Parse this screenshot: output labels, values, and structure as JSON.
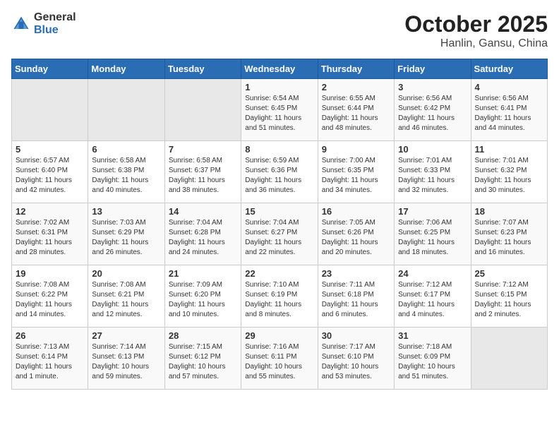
{
  "header": {
    "logo_general": "General",
    "logo_blue": "Blue",
    "title": "October 2025",
    "subtitle": "Hanlin, Gansu, China"
  },
  "weekdays": [
    "Sunday",
    "Monday",
    "Tuesday",
    "Wednesday",
    "Thursday",
    "Friday",
    "Saturday"
  ],
  "weeks": [
    [
      {
        "day": "",
        "info": ""
      },
      {
        "day": "",
        "info": ""
      },
      {
        "day": "",
        "info": ""
      },
      {
        "day": "1",
        "info": "Sunrise: 6:54 AM\nSunset: 6:45 PM\nDaylight: 11 hours\nand 51 minutes."
      },
      {
        "day": "2",
        "info": "Sunrise: 6:55 AM\nSunset: 6:44 PM\nDaylight: 11 hours\nand 48 minutes."
      },
      {
        "day": "3",
        "info": "Sunrise: 6:56 AM\nSunset: 6:42 PM\nDaylight: 11 hours\nand 46 minutes."
      },
      {
        "day": "4",
        "info": "Sunrise: 6:56 AM\nSunset: 6:41 PM\nDaylight: 11 hours\nand 44 minutes."
      }
    ],
    [
      {
        "day": "5",
        "info": "Sunrise: 6:57 AM\nSunset: 6:40 PM\nDaylight: 11 hours\nand 42 minutes."
      },
      {
        "day": "6",
        "info": "Sunrise: 6:58 AM\nSunset: 6:38 PM\nDaylight: 11 hours\nand 40 minutes."
      },
      {
        "day": "7",
        "info": "Sunrise: 6:58 AM\nSunset: 6:37 PM\nDaylight: 11 hours\nand 38 minutes."
      },
      {
        "day": "8",
        "info": "Sunrise: 6:59 AM\nSunset: 6:36 PM\nDaylight: 11 hours\nand 36 minutes."
      },
      {
        "day": "9",
        "info": "Sunrise: 7:00 AM\nSunset: 6:35 PM\nDaylight: 11 hours\nand 34 minutes."
      },
      {
        "day": "10",
        "info": "Sunrise: 7:01 AM\nSunset: 6:33 PM\nDaylight: 11 hours\nand 32 minutes."
      },
      {
        "day": "11",
        "info": "Sunrise: 7:01 AM\nSunset: 6:32 PM\nDaylight: 11 hours\nand 30 minutes."
      }
    ],
    [
      {
        "day": "12",
        "info": "Sunrise: 7:02 AM\nSunset: 6:31 PM\nDaylight: 11 hours\nand 28 minutes."
      },
      {
        "day": "13",
        "info": "Sunrise: 7:03 AM\nSunset: 6:29 PM\nDaylight: 11 hours\nand 26 minutes."
      },
      {
        "day": "14",
        "info": "Sunrise: 7:04 AM\nSunset: 6:28 PM\nDaylight: 11 hours\nand 24 minutes."
      },
      {
        "day": "15",
        "info": "Sunrise: 7:04 AM\nSunset: 6:27 PM\nDaylight: 11 hours\nand 22 minutes."
      },
      {
        "day": "16",
        "info": "Sunrise: 7:05 AM\nSunset: 6:26 PM\nDaylight: 11 hours\nand 20 minutes."
      },
      {
        "day": "17",
        "info": "Sunrise: 7:06 AM\nSunset: 6:25 PM\nDaylight: 11 hours\nand 18 minutes."
      },
      {
        "day": "18",
        "info": "Sunrise: 7:07 AM\nSunset: 6:23 PM\nDaylight: 11 hours\nand 16 minutes."
      }
    ],
    [
      {
        "day": "19",
        "info": "Sunrise: 7:08 AM\nSunset: 6:22 PM\nDaylight: 11 hours\nand 14 minutes."
      },
      {
        "day": "20",
        "info": "Sunrise: 7:08 AM\nSunset: 6:21 PM\nDaylight: 11 hours\nand 12 minutes."
      },
      {
        "day": "21",
        "info": "Sunrise: 7:09 AM\nSunset: 6:20 PM\nDaylight: 11 hours\nand 10 minutes."
      },
      {
        "day": "22",
        "info": "Sunrise: 7:10 AM\nSunset: 6:19 PM\nDaylight: 11 hours\nand 8 minutes."
      },
      {
        "day": "23",
        "info": "Sunrise: 7:11 AM\nSunset: 6:18 PM\nDaylight: 11 hours\nand 6 minutes."
      },
      {
        "day": "24",
        "info": "Sunrise: 7:12 AM\nSunset: 6:17 PM\nDaylight: 11 hours\nand 4 minutes."
      },
      {
        "day": "25",
        "info": "Sunrise: 7:12 AM\nSunset: 6:15 PM\nDaylight: 11 hours\nand 2 minutes."
      }
    ],
    [
      {
        "day": "26",
        "info": "Sunrise: 7:13 AM\nSunset: 6:14 PM\nDaylight: 11 hours\nand 1 minute."
      },
      {
        "day": "27",
        "info": "Sunrise: 7:14 AM\nSunset: 6:13 PM\nDaylight: 10 hours\nand 59 minutes."
      },
      {
        "day": "28",
        "info": "Sunrise: 7:15 AM\nSunset: 6:12 PM\nDaylight: 10 hours\nand 57 minutes."
      },
      {
        "day": "29",
        "info": "Sunrise: 7:16 AM\nSunset: 6:11 PM\nDaylight: 10 hours\nand 55 minutes."
      },
      {
        "day": "30",
        "info": "Sunrise: 7:17 AM\nSunset: 6:10 PM\nDaylight: 10 hours\nand 53 minutes."
      },
      {
        "day": "31",
        "info": "Sunrise: 7:18 AM\nSunset: 6:09 PM\nDaylight: 10 hours\nand 51 minutes."
      },
      {
        "day": "",
        "info": ""
      }
    ]
  ]
}
